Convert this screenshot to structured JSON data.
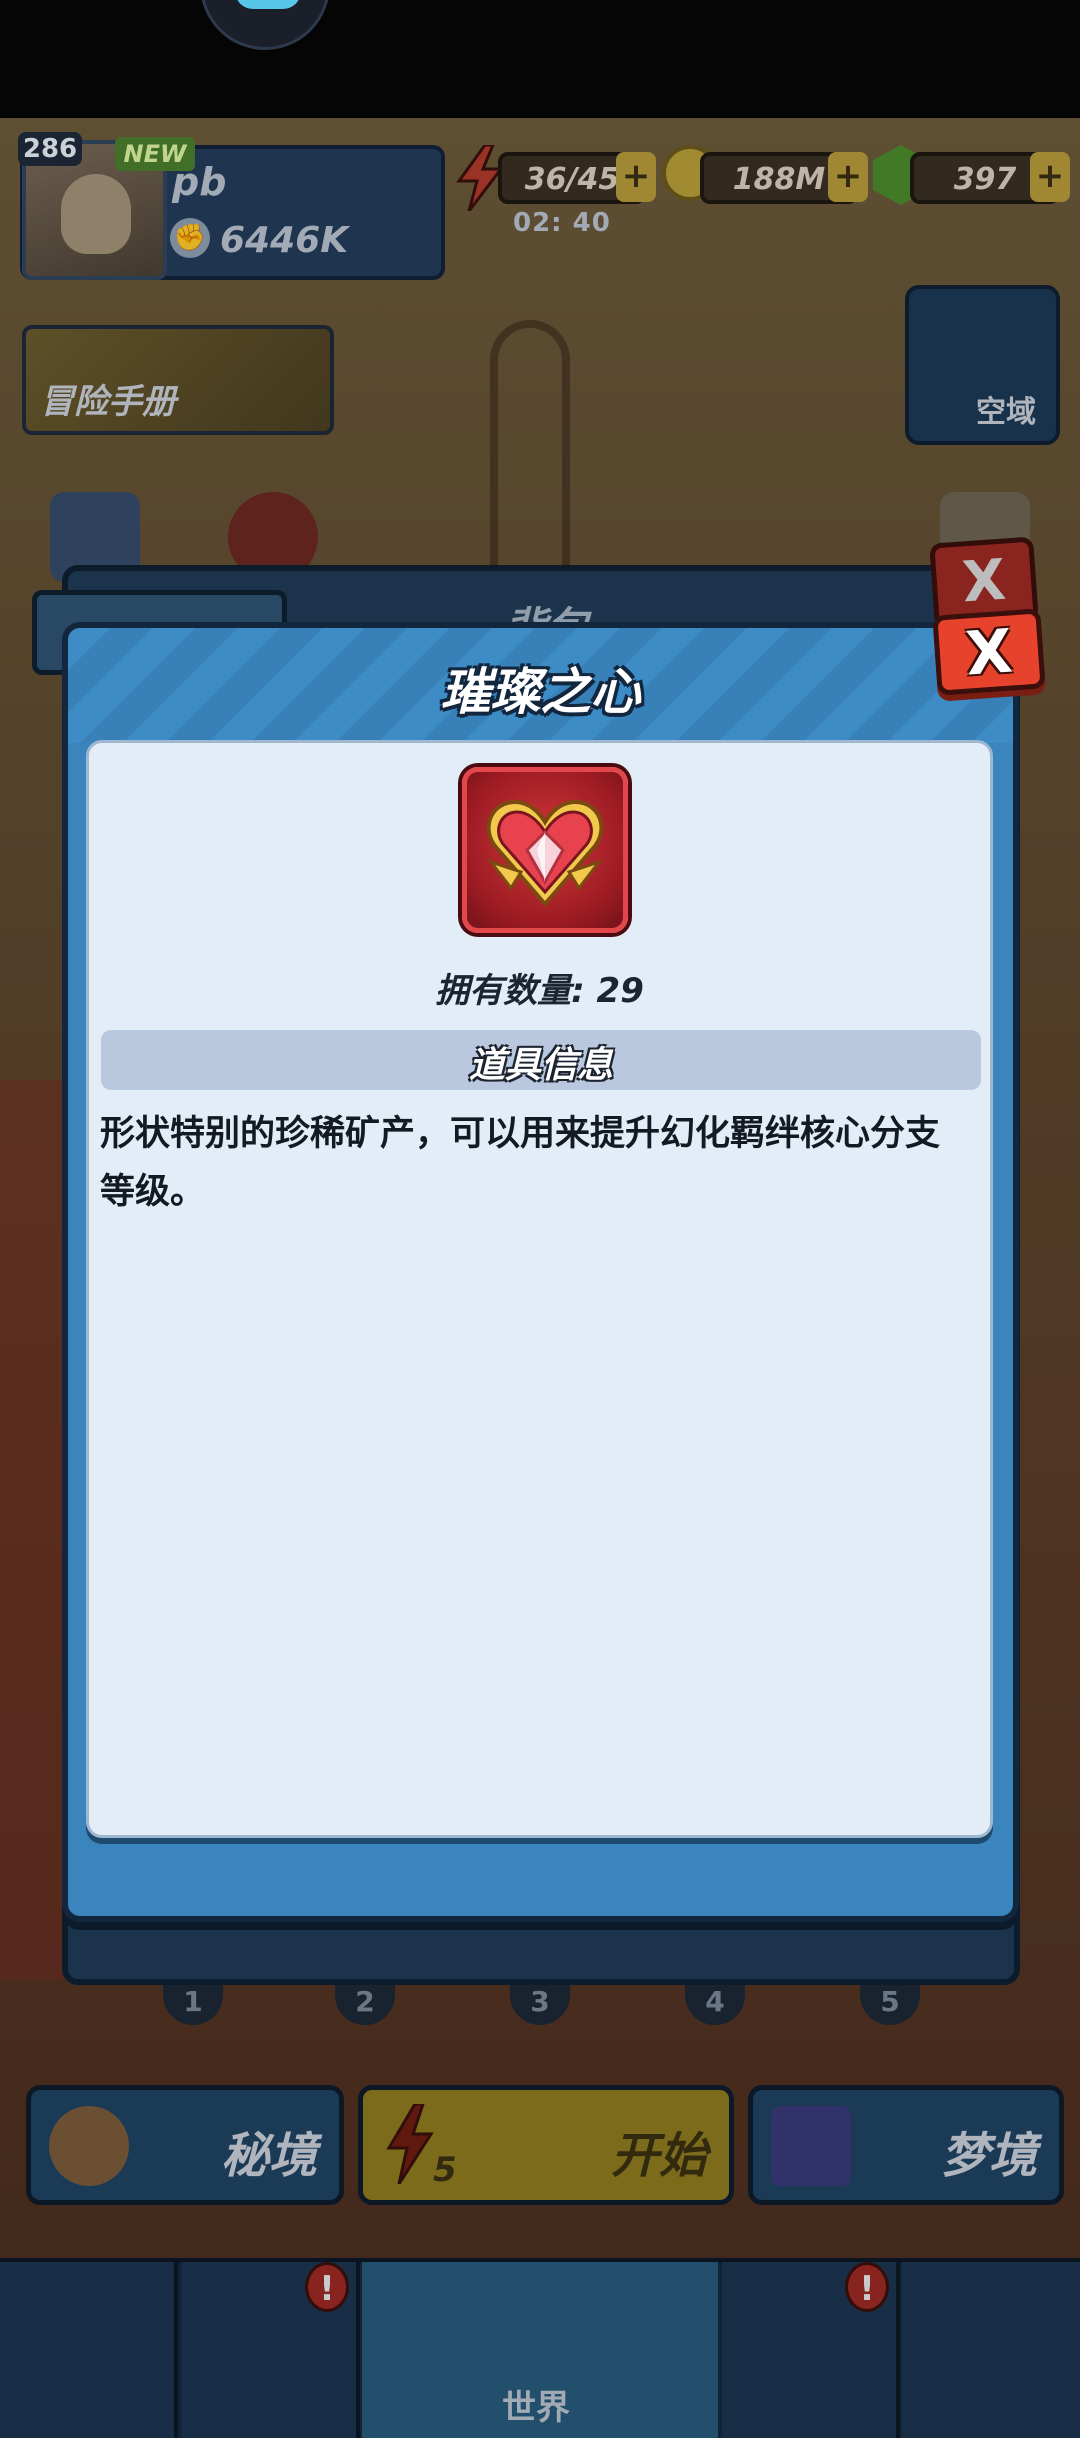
{
  "hud": {
    "level": "286",
    "new_badge": "NEW",
    "player_name": "pb",
    "power": "6446K",
    "energy": "36/45",
    "energy_timer": "02: 40",
    "gold": "188M",
    "gems": "397",
    "plus": "+"
  },
  "side": {
    "adventure_manual": "冒险手册",
    "airspace": "空域"
  },
  "backpack": {
    "title": "背包",
    "close": "X",
    "slots": [
      "1",
      "2",
      "3",
      "4",
      "5"
    ]
  },
  "actions": {
    "secret_realm": "秘境",
    "start": "开始",
    "start_cost": "5",
    "dream": "梦境"
  },
  "nav": {
    "world": "世界",
    "alert": "!"
  },
  "dialog": {
    "title": "璀璨之心",
    "close": "X",
    "quantity_label": "拥有数量: 29",
    "section_title": "道具信息",
    "description": "形状特别的珍稀矿产，可以用来提升幻化羁绊核心分支等级。"
  },
  "colors": {
    "dialog_blue": "#3a85be",
    "card_bg": "#e3edf8",
    "close_red": "#e7432c",
    "item_red": "#9c1b23",
    "gold_trim": "#f2c94c"
  },
  "icons": [
    "heart-gem-icon",
    "energy-bolt-icon",
    "gold-coin-icon",
    "gem-icon",
    "close-icon",
    "target-icon",
    "card-icon",
    "world-map-icon"
  ]
}
